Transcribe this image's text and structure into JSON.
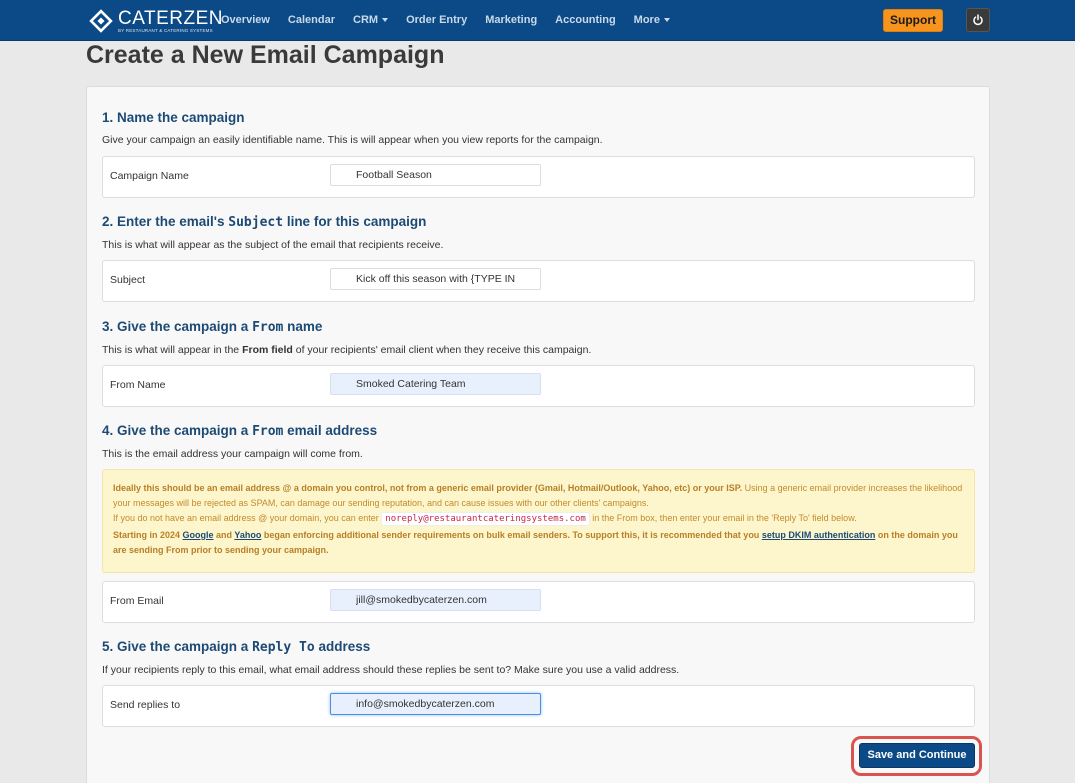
{
  "brand": {
    "name": "CATERZEN",
    "sub": "BY RESTAURANT & CATERING SYSTEMS"
  },
  "nav": {
    "items": [
      {
        "label": "Overview"
      },
      {
        "label": "Calendar"
      },
      {
        "label": "CRM",
        "dropdown": true
      },
      {
        "label": "Order Entry"
      },
      {
        "label": "Marketing"
      },
      {
        "label": "Accounting"
      },
      {
        "label": "More",
        "dropdown": true
      }
    ],
    "support_label": "Support",
    "power_icon": "power-icon"
  },
  "page_title": "Create a New Email Campaign",
  "sections": {
    "name": {
      "title": "1. Name the campaign",
      "desc": "Give your campaign an easily identifiable name. This is will appear when you view reports for the campaign.",
      "label": "Campaign Name",
      "value": "Football Season"
    },
    "subject": {
      "title_pre": "2. Enter the email's ",
      "title_code": "Subject",
      "title_post": " line for this campaign",
      "desc": "This is what will appear as the subject of the email that recipients receive.",
      "label": "Subject",
      "value": "Kick off this season with {TYPE IN"
    },
    "from_name": {
      "title_pre": "3. Give the campaign a ",
      "title_code": "From",
      "title_post": " name",
      "desc_pre": "This is what will appear in the ",
      "desc_bold": "From field",
      "desc_post": " of your recipients' email client when they receive this campaign.",
      "label": "From Name",
      "value": "Smoked Catering Team"
    },
    "from_email": {
      "title_pre": "4. Give the campaign a ",
      "title_code": "From",
      "title_post": " email address",
      "desc": "This is the email address your campaign will come from.",
      "warning": {
        "bold1": "Ideally this should be an email address @ a domain you control, not from a generic email provider (Gmail, Hotmail/Outlook, Yahoo, etc) or your ISP.",
        "text1": " Using a generic email provider increases the likelihood your messages will be rejected as SPAM, can damage our sending reputation, and can cause issues with our other clients' campaigns.",
        "text2_pre": "If you do not have an email address @ your domain, you can enter ",
        "text2_code": "noreply@restaurantcateringsystems.com",
        "text2_post": " in the From box, then enter your email in the 'Reply To' field below.",
        "bold3_a": "Starting in 2024 ",
        "link_google": "Google",
        "bold3_b": " and ",
        "link_yahoo": "Yahoo",
        "bold3_c": " began enforcing additional sender requirements on bulk email senders. To support this, it is recommended that you ",
        "link_dkim": "setup DKIM authentication",
        "bold3_d": " on the domain you are sending From prior to sending your campaign."
      },
      "label": "From Email",
      "value": "jill@smokedbycaterzen.com"
    },
    "reply_to": {
      "title_pre": "5. Give the campaign a ",
      "title_code": "Reply To",
      "title_post": " address",
      "desc": "If your recipients reply to this email, what email address should these replies be sent to? Make sure you use a valid address.",
      "label": "Send replies to",
      "value": "info@smokedbycaterzen.com"
    }
  },
  "save_label": "Save and Continue",
  "colors": {
    "nav_bg": "#0b4a86",
    "accent": "#1d4a75",
    "support": "#f7941d",
    "highlight": "#d9534f",
    "warning_bg": "#fdf6cc"
  }
}
